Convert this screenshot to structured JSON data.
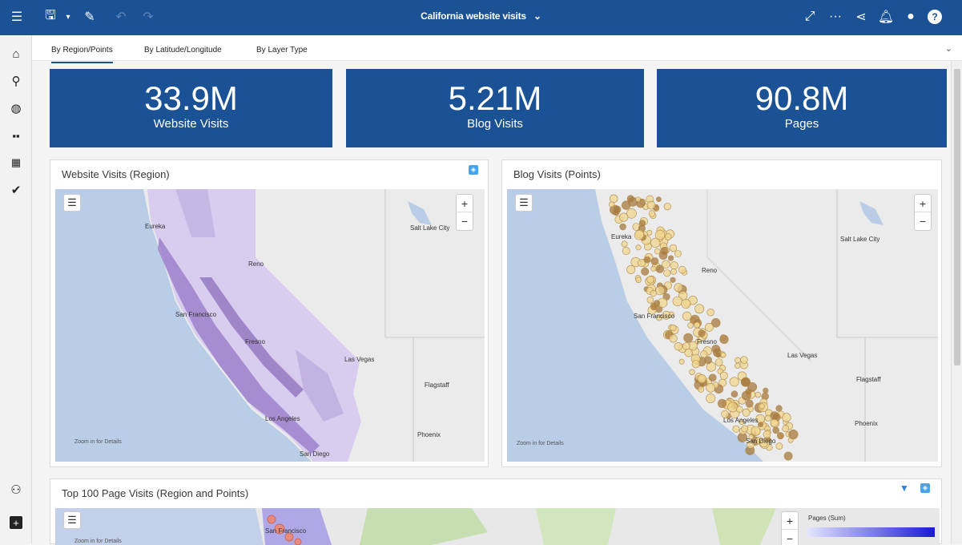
{
  "header": {
    "title": "California website visits",
    "icons": [
      "app-switcher-icon",
      "save-icon",
      "edit-icon",
      "undo-icon",
      "redo-icon",
      "expand-icon",
      "more-icon",
      "share-icon",
      "notification-icon",
      "user-icon",
      "help-icon"
    ]
  },
  "tabs": [
    {
      "label": "By Region/Points",
      "active": true
    },
    {
      "label": "By Latitude/Longitude",
      "active": false
    },
    {
      "label": "By Layer Type",
      "active": false
    }
  ],
  "kpis": [
    {
      "value": "33.9M",
      "label": "Website Visits"
    },
    {
      "value": "5.21M",
      "label": "Blog Visits"
    },
    {
      "value": "90.8M",
      "label": "Pages"
    }
  ],
  "panels": {
    "region": {
      "title": "Website Visits (Region)",
      "hint": "Zoom in for Details",
      "cities": {
        "eureka": "Eureka",
        "reno": "Reno",
        "sf": "San Francisco",
        "fresno": "Fresno",
        "lv": "Las Vegas",
        "la": "Los Angeles",
        "sd": "San Diego",
        "slc": "Salt Lake City",
        "flag": "Flagstaff",
        "phx": "Phoenix"
      }
    },
    "points": {
      "title": "Blog Visits (Points)",
      "hint": "Zoom in for Details",
      "cities": {
        "eureka": "Eureka",
        "reno": "Reno",
        "sf": "San Francisco",
        "fresno": "Fresno",
        "lv": "Las Vegas",
        "la": "Los Angeles",
        "sd": "San Diego",
        "slc": "Salt Lake City",
        "flag": "Flagstaff",
        "phx": "Phoenix"
      }
    },
    "top": {
      "title": "Top 100 Page Visits (Region and Points)",
      "hint": "Zoom in for Details",
      "city": "San Francisco",
      "legend_title": "Pages (Sum)",
      "legend_colors": [
        "#e6e6ff",
        "#1a1ad6"
      ]
    }
  },
  "map_controls": {
    "zoom_in": "+",
    "zoom_out": "−"
  },
  "colors": {
    "brand": "#1b5296",
    "region_fill": "#c9b7e6",
    "points_fill": "#e8c877",
    "ocean": "#b9cde6"
  }
}
